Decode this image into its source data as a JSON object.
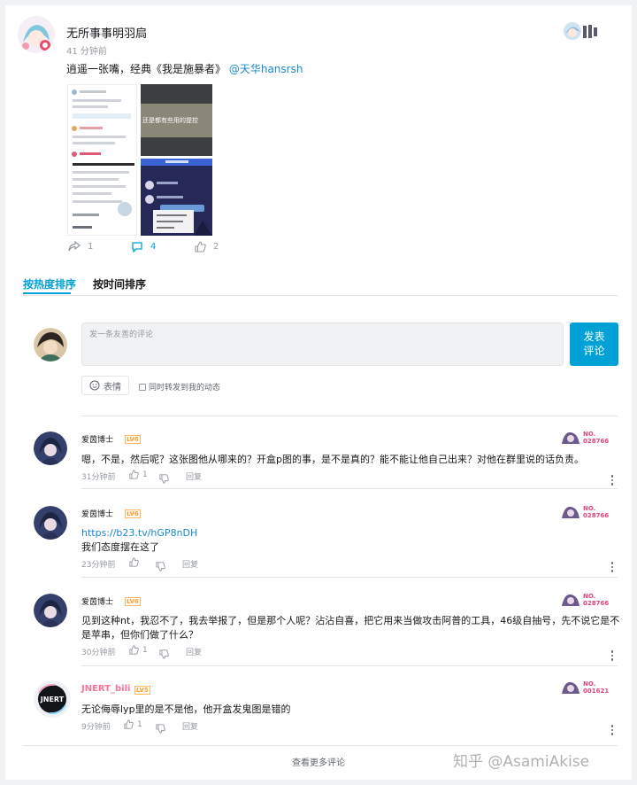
{
  "post": {
    "author": "无所事事明羽扃",
    "time": "41 分钟前",
    "text": "逍遥一张嘴，经典《我是施暴者》",
    "mention": "@天华hansrsh",
    "thumb_caption": "还是都有些用的提控",
    "actions": {
      "forward": "1",
      "comment": "4",
      "like": "2"
    }
  },
  "tabs": [
    {
      "label": "按热度排序",
      "active": true
    },
    {
      "label": "按时间排序",
      "active": false
    }
  ],
  "composer": {
    "placeholder": "发一条友善的评论",
    "submit_line1": "发表",
    "submit_line2": "评论",
    "emoji_label": "表情",
    "sync_label": "同时转发到我的动态"
  },
  "comments": [
    {
      "user": "爱茵博士",
      "level": "LV6",
      "medal_top": "NO.",
      "medal_bottom": "028766",
      "lines": [
        "嗯，不是，然后呢？这张图他从哪来的？开盒p图的事，是不是真的？能不能让他自己出来？对他在群里说的话负责。"
      ],
      "link": "",
      "time": "31分钟前",
      "likes": "1",
      "reply": "回复"
    },
    {
      "user": "爱茵博士",
      "level": "LV6",
      "medal_top": "NO.",
      "medal_bottom": "028766",
      "link": "https://b23.tv/hGP8nDH",
      "lines": [
        "我们态度摆在这了"
      ],
      "time": "23分钟前",
      "likes": "",
      "reply": "回复"
    },
    {
      "user": "爱茵博士",
      "level": "LV6",
      "medal_top": "NO.",
      "medal_bottom": "028766",
      "link": "",
      "lines": [
        "见到这种nt，我忍不了，我去举报了，但是那个人呢？沾沾自喜，把它用来当做攻击阿普的工具，46级自抽号，先不说它是不",
        "是苹串，但你们做了什么？"
      ],
      "time": "30分钟前",
      "likes": "1",
      "reply": "回复"
    },
    {
      "user": "JNERT_bili",
      "level": "LV5",
      "medal_top": "NO.",
      "medal_bottom": "001621",
      "link": "",
      "lines": [
        "无论侮辱lyp里的是不是他，他开盒发鬼图是错的"
      ],
      "time": "9分钟前",
      "likes": "1",
      "reply": "回复"
    }
  ],
  "more_comments": "查看更多评论",
  "watermark": "知乎 @AsamiAkise",
  "colors": {
    "accent": "#00a1d6",
    "link": "#178bcf",
    "level": "#ff9e2a",
    "special_name": "#fb7299"
  }
}
